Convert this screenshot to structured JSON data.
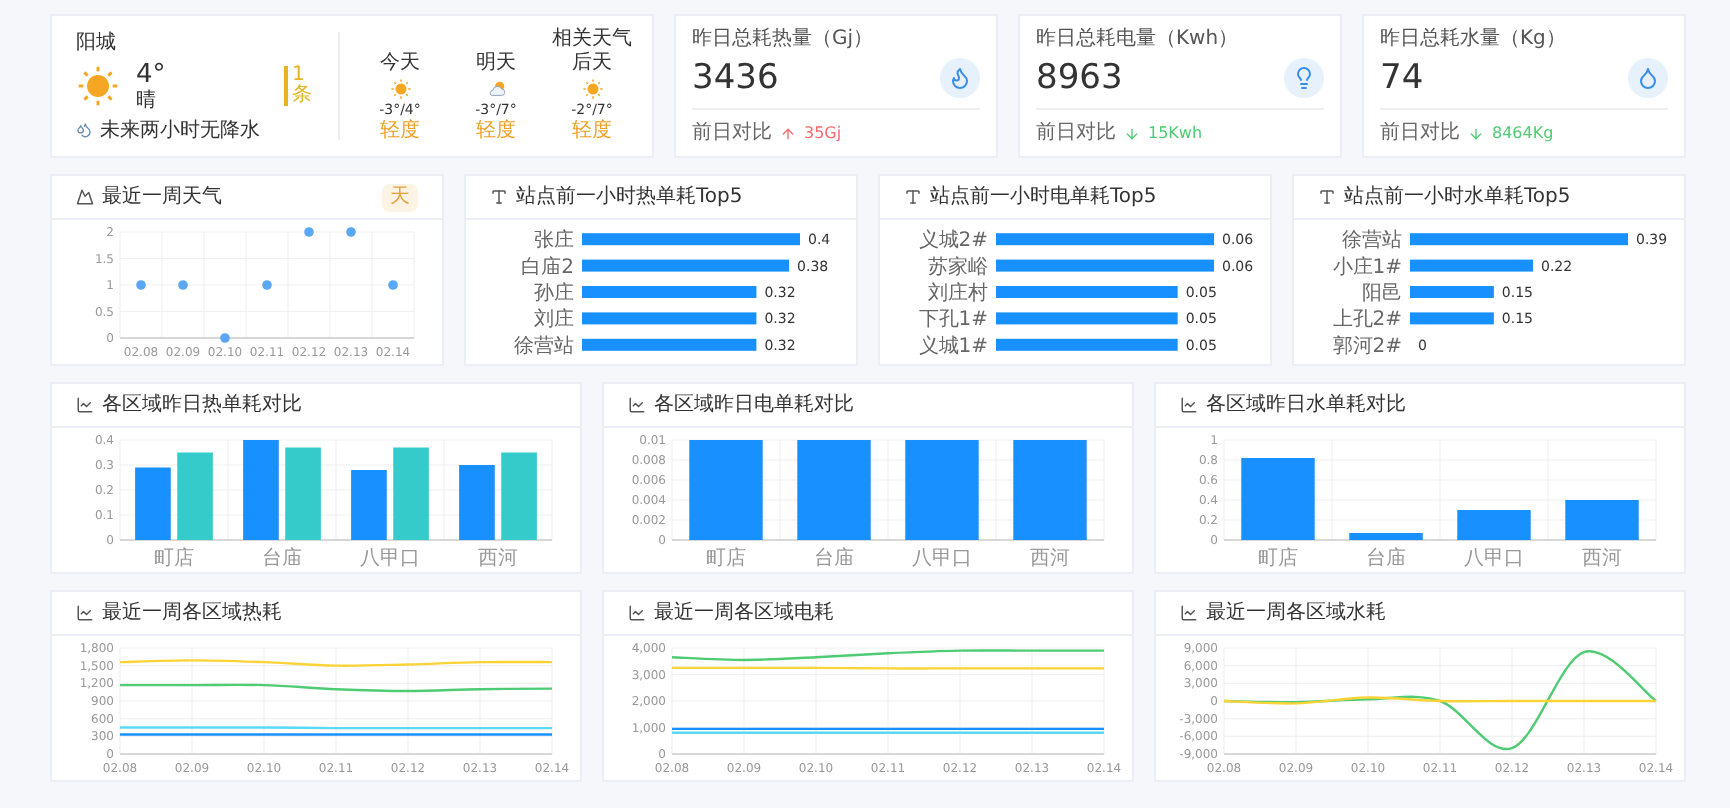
{
  "weather": {
    "city": "阳城",
    "temperature": "4°",
    "condition": "晴",
    "rain_note": "未来两小时无降水",
    "alert": "1条",
    "forecast": [
      {
        "day": "今天",
        "kind": "sunny",
        "temp": "-3°/4°",
        "quality": "轻度"
      },
      {
        "day": "明天",
        "kind": "partly_cloudy",
        "temp": "-3°/7°",
        "quality": "轻度"
      },
      {
        "day": "后天",
        "note": "相关天气",
        "kind": "sunny",
        "temp": "-2°/7°",
        "quality": "轻度"
      }
    ]
  },
  "kpis": [
    {
      "title": "昨日总耗热量（Gj）",
      "value": "3436",
      "kind": "heat",
      "compare_label": "前日对比",
      "change": {
        "kind": "up",
        "text": "35Gj"
      }
    },
    {
      "title": "昨日总耗电量（Kwh）",
      "value": "8963",
      "kind": "power",
      "compare_label": "前日对比",
      "change": {
        "kind": "down",
        "text": "15Kwh"
      }
    },
    {
      "title": "昨日总耗水量（Kg）",
      "value": "74",
      "kind": "water",
      "compare_label": "前日对比",
      "change": {
        "kind": "down",
        "text": "8464Kg"
      }
    }
  ],
  "panels": [
    {
      "title": "最近一周天气",
      "kind": "weather",
      "badge": "天",
      "chart_data": {
        "type": "scatter",
        "x": [
          "02.08",
          "02.09",
          "02.10",
          "02.11",
          "02.12",
          "02.13",
          "02.14"
        ],
        "values": [
          1,
          1,
          0,
          1,
          2,
          2,
          1
        ],
        "ylim": [
          0,
          2
        ],
        "yticks": [
          0,
          0.5,
          1,
          1.5,
          2
        ],
        "grid": true
      }
    },
    {
      "title": "站点前一小时热单耗Top5",
      "kind": "rank",
      "chart_data": {
        "type": "bar",
        "orientation": "horizontal",
        "categories": [
          "张庄",
          "白庙2",
          "孙庄",
          "刘庄",
          "徐营站"
        ],
        "series": [
          {
            "color": "#1890ff",
            "values": [
              0.4,
              0.38,
              0.32,
              0.32,
              0.32
            ]
          }
        ],
        "data_labels": true
      }
    },
    {
      "title": "站点前一小时电单耗Top5",
      "kind": "rank",
      "chart_data": {
        "type": "bar",
        "orientation": "horizontal",
        "categories": [
          "义城2#",
          "苏家峪",
          "刘庄村",
          "下孔1#",
          "义城1#"
        ],
        "series": [
          {
            "color": "#1890ff",
            "values": [
              0.06,
              0.06,
              0.05,
              0.05,
              0.05
            ]
          }
        ],
        "data_labels": true
      }
    },
    {
      "title": "站点前一小时水单耗Top5",
      "kind": "rank",
      "chart_data": {
        "type": "bar",
        "orientation": "horizontal",
        "categories": [
          "徐营站",
          "小庄1#",
          "阳邑",
          "上孔2#",
          "郭河2#"
        ],
        "series": [
          {
            "color": "#1890ff",
            "values": [
              0.39,
              0.22,
              0.15,
              0.15,
              0
            ]
          }
        ],
        "data_labels": true
      }
    },
    {
      "title": "各区域昨日热单耗对比",
      "kind": "chart",
      "chart_data": {
        "type": "bar",
        "categories": [
          "町店",
          "台庙",
          "八甲口",
          "西河"
        ],
        "series": [
          {
            "color": "#1890ff",
            "values": [
              0.29,
              0.4,
              0.28,
              0.3
            ]
          },
          {
            "color": "#36cbcb",
            "values": [
              0.35,
              0.37,
              0.37,
              0.35
            ]
          }
        ],
        "ylim": [
          0,
          0.4
        ],
        "yticks": [
          0,
          0.1,
          0.2,
          0.3,
          0.4
        ],
        "grid": true
      }
    },
    {
      "title": "各区域昨日电单耗对比",
      "kind": "chart",
      "chart_data": {
        "type": "bar",
        "categories": [
          "町店",
          "台庙",
          "八甲口",
          "西河"
        ],
        "series": [
          {
            "color": "#1890ff",
            "values": [
              0.01,
              0.01,
              0.01,
              0.01
            ]
          }
        ],
        "ylim": [
          0,
          0.01
        ],
        "yticks": [
          0,
          0.002,
          0.004,
          0.006,
          0.008,
          0.01
        ],
        "grid": true
      }
    },
    {
      "title": "各区域昨日水单耗对比",
      "kind": "chart",
      "chart_data": {
        "type": "bar",
        "categories": [
          "町店",
          "台庙",
          "八甲口",
          "西河"
        ],
        "series": [
          {
            "color": "#1890ff",
            "values": [
              0.82,
              0.07,
              0.3,
              0.4
            ]
          }
        ],
        "ylim": [
          0,
          1
        ],
        "yticks": [
          0,
          0.2,
          0.4,
          0.6,
          0.8,
          1
        ],
        "grid": true
      }
    },
    {
      "title": "最近一周各区域热耗",
      "kind": "chart",
      "chart_data": {
        "type": "line",
        "x": [
          "02.08",
          "02.09",
          "02.10",
          "02.11",
          "02.12",
          "02.13",
          "02.14"
        ],
        "series": [
          {
            "color": "#fad337",
            "values": [
              1560,
              1590,
              1560,
              1500,
              1520,
              1560,
              1560
            ]
          },
          {
            "color": "#4ecb73",
            "values": [
              1170,
              1170,
              1170,
              1100,
              1070,
              1100,
              1110
            ]
          },
          {
            "color": "#58d9f9",
            "values": [
              450,
              450,
              450,
              440,
              440,
              440,
              440
            ]
          },
          {
            "color": "#1890ff",
            "values": [
              330,
              330,
              330,
              330,
              330,
              330,
              330
            ]
          }
        ],
        "ylim": [
          0,
          1800
        ],
        "yticks": [
          {
            "value": 0,
            "label": "0"
          },
          {
            "value": 300,
            "label": "300"
          },
          {
            "value": 600,
            "label": "600"
          },
          {
            "value": 900,
            "label": "900"
          },
          {
            "value": 1200,
            "label": "1,200"
          },
          {
            "value": 1500,
            "label": "1,500"
          },
          {
            "value": 1800,
            "label": "1,800"
          }
        ],
        "grid": true
      }
    },
    {
      "title": "最近一周各区域电耗",
      "kind": "chart",
      "chart_data": {
        "type": "line",
        "x": [
          "02.08",
          "02.09",
          "02.10",
          "02.11",
          "02.12",
          "02.13",
          "02.14"
        ],
        "series": [
          {
            "color": "#4ecb73",
            "values": [
              3650,
              3550,
              3650,
              3800,
              3900,
              3900,
              3900
            ]
          },
          {
            "color": "#fad337",
            "values": [
              3250,
              3250,
              3250,
              3230,
              3230,
              3230,
              3230
            ]
          },
          {
            "color": "#58d9f9",
            "values": [
              800,
              800,
              800,
              800,
              800,
              800,
              800
            ]
          },
          {
            "color": "#1890ff",
            "values": [
              950,
              950,
              950,
              950,
              950,
              950,
              950
            ]
          }
        ],
        "ylim": [
          0,
          4000
        ],
        "yticks": [
          {
            "value": 0,
            "label": "0"
          },
          {
            "value": 1000,
            "label": "1,000"
          },
          {
            "value": 2000,
            "label": "2,000"
          },
          {
            "value": 3000,
            "label": "3,000"
          },
          {
            "value": 4000,
            "label": "4,000"
          }
        ],
        "grid": true
      }
    },
    {
      "title": "最近一周各区域水耗",
      "kind": "chart",
      "chart_data": {
        "type": "line",
        "x": [
          "02.08",
          "02.09",
          "02.10",
          "02.11",
          "02.12",
          "02.13",
          "02.14"
        ],
        "series": [
          {
            "color": "#4ecb73",
            "values": [
              0,
              -200,
              300,
              0,
              -8000,
              8300,
              0
            ]
          },
          {
            "color": "#fad337",
            "values": [
              0,
              -400,
              600,
              0,
              0,
              0,
              0
            ]
          }
        ],
        "ylim": [
          -9000,
          9000
        ],
        "yticks": [
          {
            "value": -9000,
            "label": "-9,000"
          },
          {
            "value": -6000,
            "label": "-6,000"
          },
          {
            "value": -3000,
            "label": "-3,000"
          },
          {
            "value": 0,
            "label": "0"
          },
          {
            "value": 3000,
            "label": "3,000"
          },
          {
            "value": 6000,
            "label": "6,000"
          },
          {
            "value": 9000,
            "label": "9,000"
          }
        ],
        "grid": true
      }
    }
  ]
}
